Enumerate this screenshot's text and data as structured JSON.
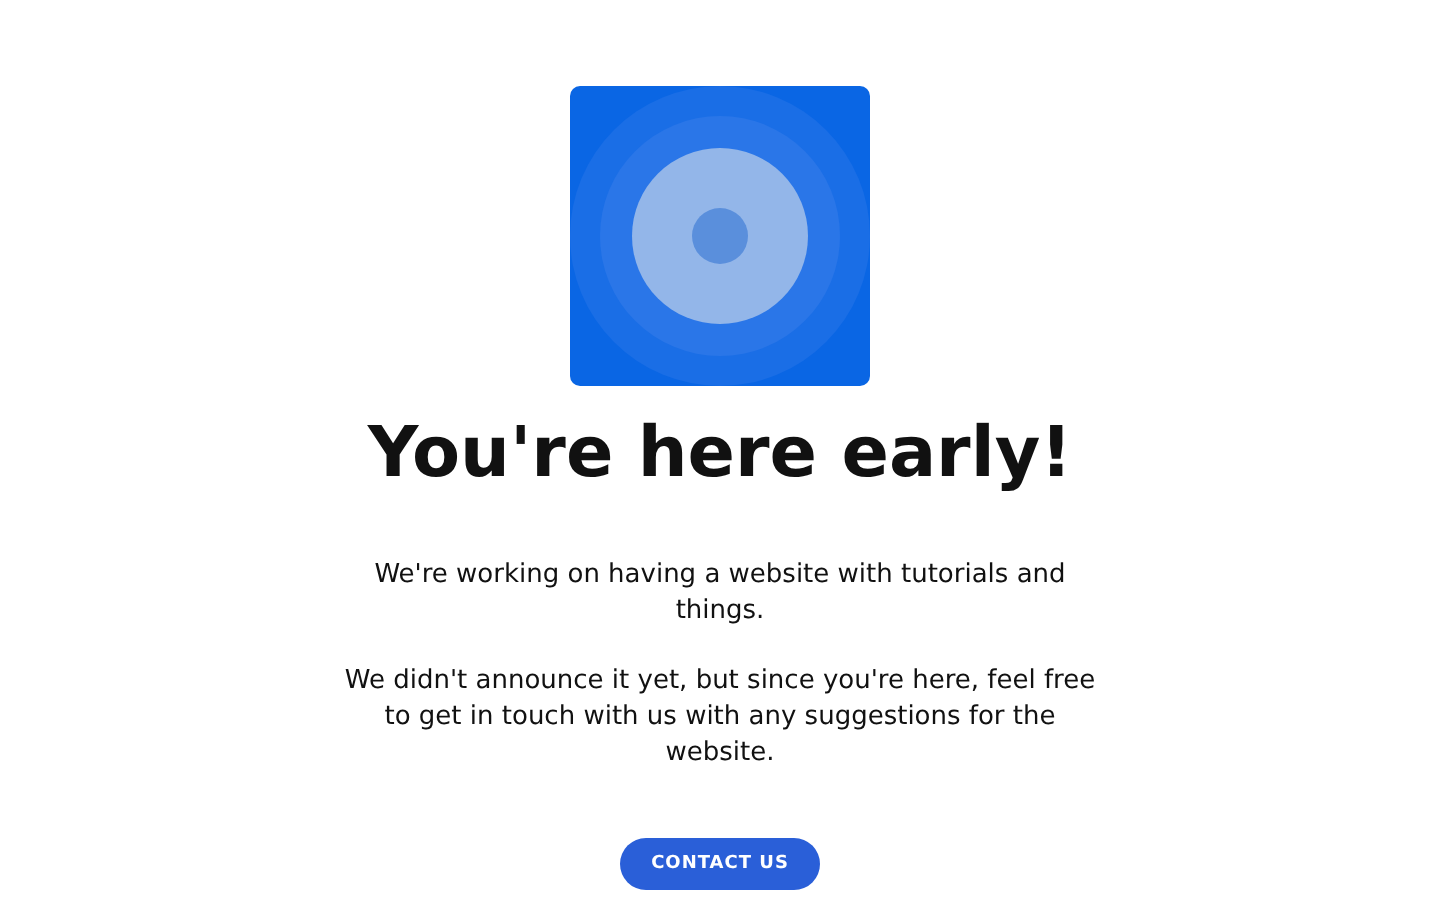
{
  "heading": "You're here early!",
  "paragraphs": [
    "We're working on having a website with tutorials and things.",
    "We didn't announce it yet, but since you're here, feel free to get in touch with us with any suggestions for the website."
  ],
  "button": "CONTACT US"
}
